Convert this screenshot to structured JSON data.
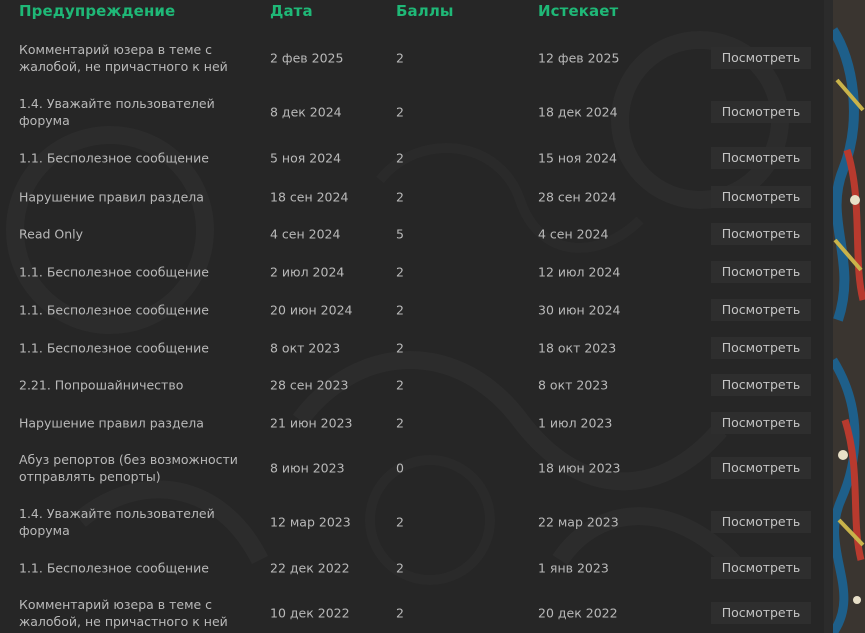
{
  "headers": {
    "warning": "Предупреждение",
    "date": "Дата",
    "points": "Баллы",
    "expires": "Истекает"
  },
  "view_label": "Посмотреть",
  "colors": {
    "header_accent": "#1fb877",
    "panel_bg": "#262626",
    "text": "#b9b9b9",
    "button_bg": "#2e2e2e"
  },
  "rows": [
    {
      "warning": "Комментарий юзера в теме с жалобой, не причастного к ней",
      "date": "2 фев 2025",
      "points": "2",
      "expires": "12 фев 2025"
    },
    {
      "warning": "1.4. Уважайте пользователей форума",
      "date": "8 дек 2024",
      "points": "2",
      "expires": "18 дек 2024"
    },
    {
      "warning": "1.1. Бесполезное сообщение",
      "date": "5 ноя 2024",
      "points": "2",
      "expires": "15 ноя 2024"
    },
    {
      "warning": "Нарушение правил раздела",
      "date": "18 сен 2024",
      "points": "2",
      "expires": "28 сен 2024"
    },
    {
      "warning": "Read Only",
      "date": "4 сен 2024",
      "points": "5",
      "expires": "4 сен 2024"
    },
    {
      "warning": "1.1. Бесполезное сообщение",
      "date": "2 июл 2024",
      "points": "2",
      "expires": "12 июл 2024"
    },
    {
      "warning": "1.1. Бесполезное сообщение",
      "date": "20 июн 2024",
      "points": "2",
      "expires": "30 июн 2024"
    },
    {
      "warning": "1.1. Бесполезное сообщение",
      "date": "8 окт 2023",
      "points": "2",
      "expires": "18 окт 2023"
    },
    {
      "warning": "2.21. Попрошайничество",
      "date": "28 сен 2023",
      "points": "2",
      "expires": "8 окт 2023"
    },
    {
      "warning": "Нарушение правил раздела",
      "date": "21 июн 2023",
      "points": "2",
      "expires": "1 июл 2023"
    },
    {
      "warning": "Абуз репортов (без возможности отправлять репорты)",
      "date": "8 июн 2023",
      "points": "0",
      "expires": "18 июн 2023"
    },
    {
      "warning": "1.4. Уважайте пользователей форума",
      "date": "12 мар 2023",
      "points": "2",
      "expires": "22 мар 2023"
    },
    {
      "warning": "1.1. Бесполезное сообщение",
      "date": "22 дек 2022",
      "points": "2",
      "expires": "1 янв 2023"
    },
    {
      "warning": "Комментарий юзера в теме с жалобой, не причастного к ней",
      "date": "10 дек 2022",
      "points": "2",
      "expires": "20 дек 2022"
    }
  ]
}
